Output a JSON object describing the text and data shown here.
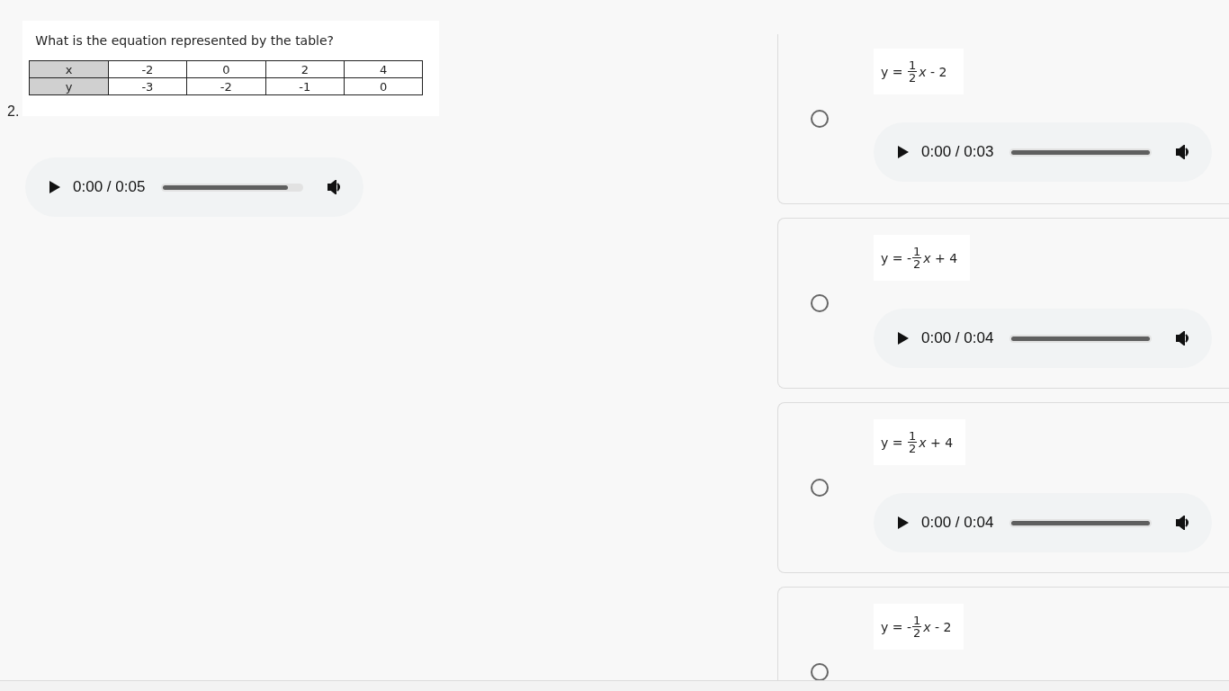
{
  "question": {
    "number": "2.",
    "prompt": "What is the equation represented by the table?",
    "table": {
      "rows": [
        {
          "label": "x",
          "cells": [
            "-2",
            "0",
            "2",
            "4"
          ]
        },
        {
          "label": "y",
          "cells": [
            "-3",
            "-2",
            "-1",
            "0"
          ]
        }
      ]
    },
    "audio": {
      "time": "0:00 / 0:05",
      "level": 0.9
    }
  },
  "options": [
    {
      "selected": false,
      "equation": {
        "prefix": "y = ",
        "numerator": "1",
        "denominator": "2",
        "variable": "x",
        "tail": " - 2"
      },
      "audio": {
        "time": "0:00 / 0:03",
        "level": 1
      }
    },
    {
      "selected": false,
      "equation": {
        "prefix": "y = -",
        "numerator": "1",
        "denominator": "2",
        "variable": "x",
        "tail": " + 4"
      },
      "audio": {
        "time": "0:00 / 0:04",
        "level": 1
      }
    },
    {
      "selected": false,
      "equation": {
        "prefix": "y = ",
        "numerator": "1",
        "denominator": "2",
        "variable": "x",
        "tail": " + 4"
      },
      "audio": {
        "time": "0:00 / 0:04",
        "level": 1
      }
    },
    {
      "selected": false,
      "equation": {
        "prefix": "y = -",
        "numerator": "1",
        "denominator": "2",
        "variable": "x",
        "tail": " - 2"
      }
    }
  ]
}
